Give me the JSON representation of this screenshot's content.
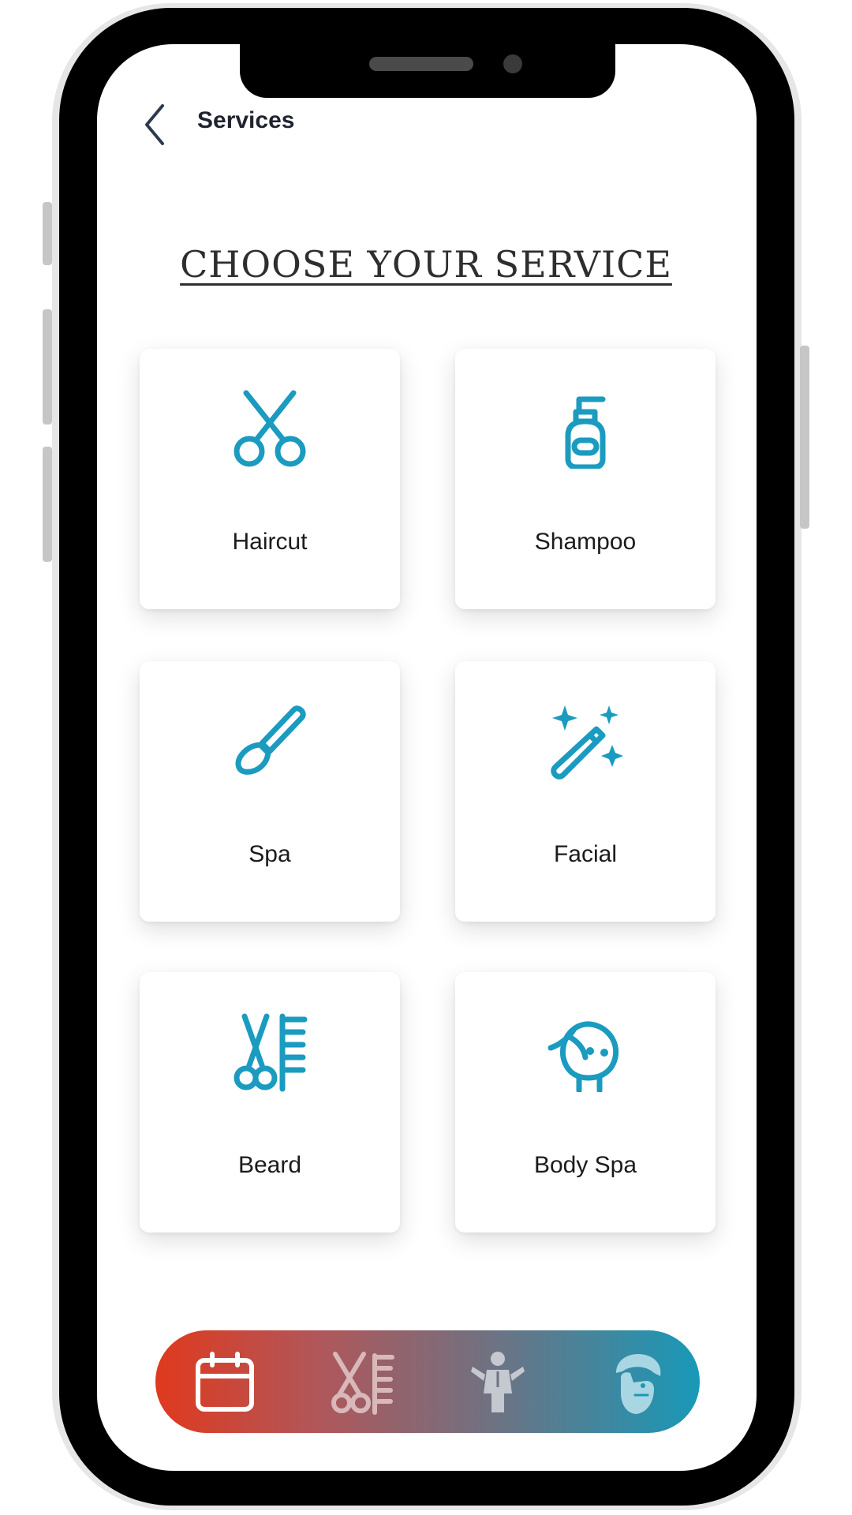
{
  "header": {
    "title": "Services",
    "back_icon": "chevron-left-icon"
  },
  "heading": "CHOOSE YOUR SERVICE",
  "accent_color": "#1a9bbf",
  "services": [
    {
      "label": "Haircut",
      "icon": "scissors-icon"
    },
    {
      "label": "Shampoo",
      "icon": "shampoo-bottle-icon"
    },
    {
      "label": "Spa",
      "icon": "brush-icon"
    },
    {
      "label": "Facial",
      "icon": "magic-wand-icon"
    },
    {
      "label": "Beard",
      "icon": "scissors-comb-icon"
    },
    {
      "label": "Body Spa",
      "icon": "face-icon"
    }
  ],
  "bottom_nav": {
    "gradient": [
      "#e0391e",
      "#1899b8"
    ],
    "items": [
      {
        "icon": "calendar-icon",
        "active": true
      },
      {
        "icon": "scissors-comb-icon",
        "active": false
      },
      {
        "icon": "stylist-icon",
        "active": false
      },
      {
        "icon": "bearded-man-icon",
        "active": false
      }
    ]
  }
}
